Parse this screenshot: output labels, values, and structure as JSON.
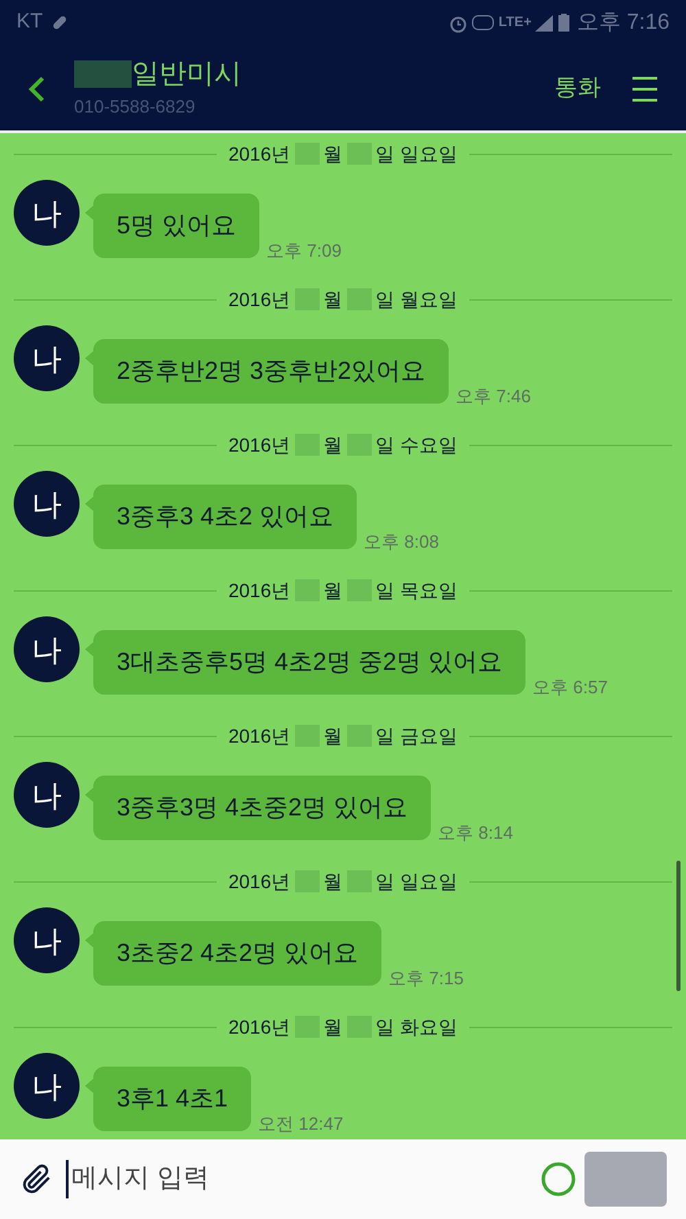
{
  "status_bar": {
    "carrier": "KT",
    "time": "오후 7:16",
    "network": "LTE+"
  },
  "header": {
    "name": "일반미시",
    "phone": "010-5588-6829",
    "call": "통화"
  },
  "messages": [
    {
      "date": {
        "year": "2016년",
        "month": "월",
        "day": "일 일요일"
      },
      "avatar": "나",
      "text": "5명 있어요",
      "time": "오후 7:09"
    },
    {
      "date": {
        "year": "2016년",
        "month": "월",
        "day": "일 월요일"
      },
      "avatar": "나",
      "text": "2중후반2명 3중후반2있어요",
      "time": "오후 7:46"
    },
    {
      "date": {
        "year": "2016년",
        "month": "월",
        "day": "일 수요일"
      },
      "avatar": "나",
      "text": "3중후3 4초2 있어요",
      "time": "오후 8:08"
    },
    {
      "date": {
        "year": "2016년",
        "month": "월",
        "day": "일 목요일"
      },
      "avatar": "나",
      "text": "3대초중후5명 4초2명 중2명 있어요",
      "time": "오후 6:57"
    },
    {
      "date": {
        "year": "2016년",
        "month": "월",
        "day": "일 금요일"
      },
      "avatar": "나",
      "text": "3중후3명 4초중2명 있어요",
      "time": "오후 8:14"
    },
    {
      "date": {
        "year": "2016년",
        "month": "월",
        "day": "일 일요일"
      },
      "avatar": "나",
      "text": "3초중2 4초2명 있어요",
      "time": "오후 7:15"
    },
    {
      "date": {
        "year": "2016년",
        "month": "월",
        "day": "일 화요일"
      },
      "avatar": "나",
      "text": "3후1 4초1",
      "time": "오전 12:47"
    }
  ],
  "composer": {
    "placeholder": "메시지 입력"
  }
}
